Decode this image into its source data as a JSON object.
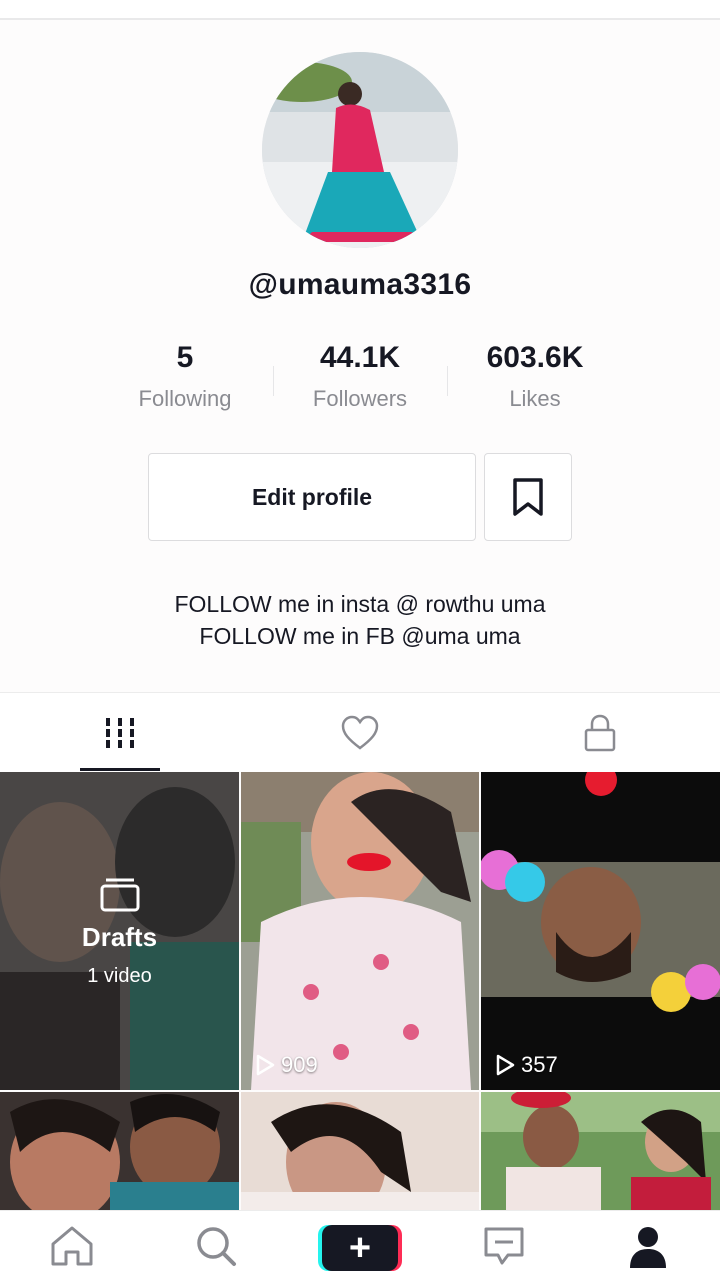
{
  "profile": {
    "username": "@umauma3316",
    "stats": [
      {
        "value": "5",
        "label": "Following"
      },
      {
        "value": "44.1K",
        "label": "Followers"
      },
      {
        "value": "603.6K",
        "label": "Likes"
      }
    ],
    "edit_label": "Edit profile",
    "bio_lines": [
      "FOLLOW me in insta @ rowthu uma",
      "FOLLOW me in FB @uma uma"
    ]
  },
  "tabs": [
    {
      "name": "videos",
      "icon": "grid-icon",
      "active": true
    },
    {
      "name": "liked",
      "icon": "heart-icon",
      "active": false
    },
    {
      "name": "private",
      "icon": "lock-icon",
      "active": false
    }
  ],
  "grid": {
    "drafts": {
      "title": "Drafts",
      "count": "1 video"
    },
    "videos": [
      {
        "views": "909"
      },
      {
        "views": "357"
      }
    ]
  },
  "nav": [
    "home-icon",
    "search-icon",
    "create-button",
    "inbox-icon",
    "profile-icon"
  ],
  "colors": {
    "accent_pink": "#fe2c55",
    "accent_cyan": "#25f4ee",
    "text": "#161823",
    "muted": "#8a8b91"
  }
}
